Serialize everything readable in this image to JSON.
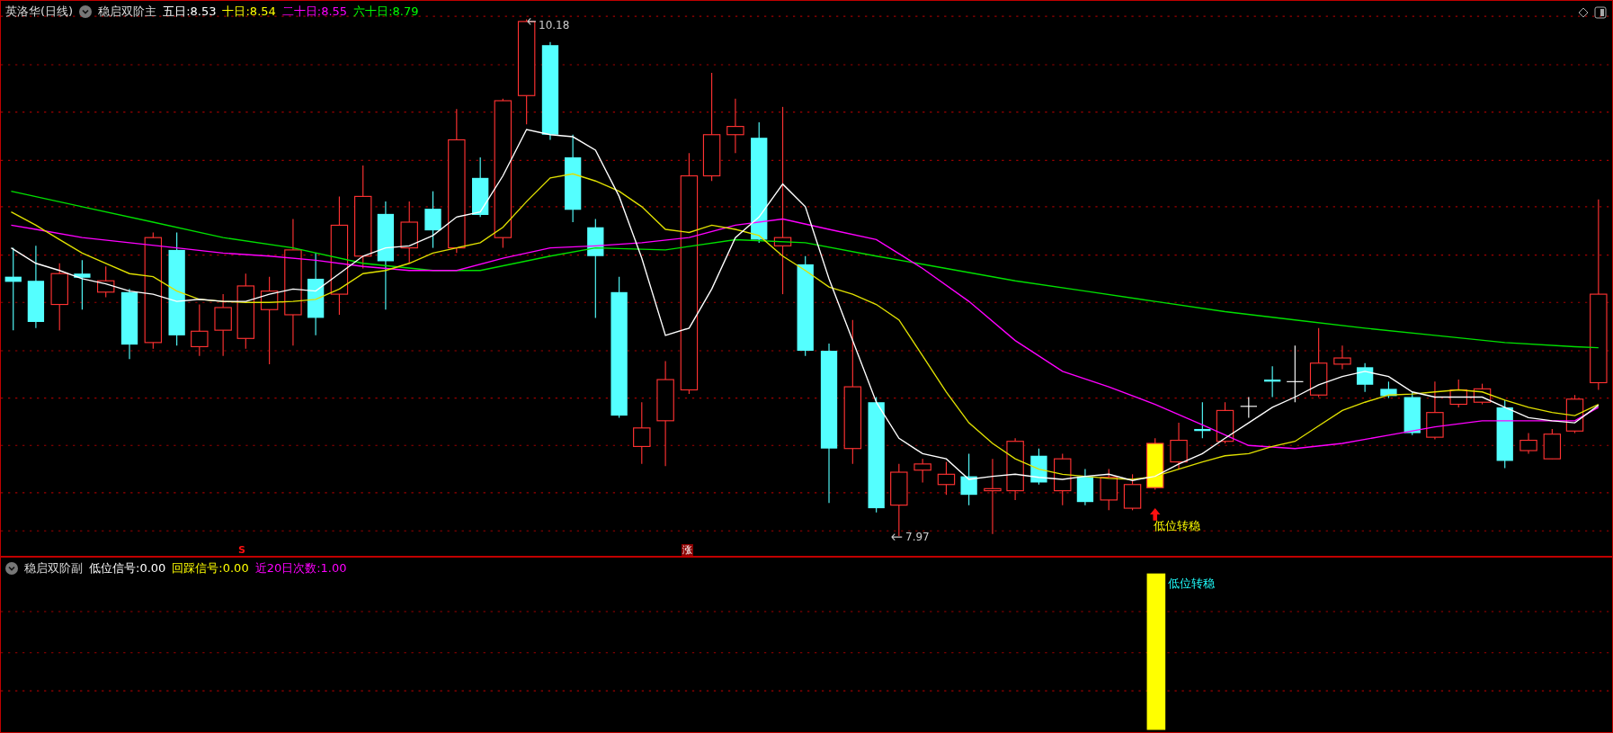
{
  "main_panel": {
    "title": "英洛华(日线)",
    "indicator": "稳启双阶主",
    "legend": [
      {
        "label": "五日:",
        "value": "8.53",
        "color": "#ffffff"
      },
      {
        "label": "十日:",
        "value": "8.54",
        "color": "#ffff00"
      },
      {
        "label": "二十日:",
        "value": "8.55",
        "color": "#ff00ff"
      },
      {
        "label": "六十日:",
        "value": "8.79",
        "color": "#00ff00"
      }
    ],
    "high_label": "10.18",
    "low_label": "7.97",
    "signal_label": "低位转稳",
    "markers": [
      {
        "kind": "sell",
        "text": "S"
      },
      {
        "kind": "rise",
        "text": "涨"
      }
    ]
  },
  "sub_panel": {
    "indicator": "稳启双阶副",
    "legend": [
      {
        "label": "低位信号:",
        "value": "0.00",
        "color": "#ffffff"
      },
      {
        "label": "回踩信号:",
        "value": "0.00",
        "color": "#ffff00"
      },
      {
        "label": "近20日次数:",
        "value": "1.00",
        "color": "#ff00ff"
      }
    ],
    "signal_label": "低位转稳"
  }
}
